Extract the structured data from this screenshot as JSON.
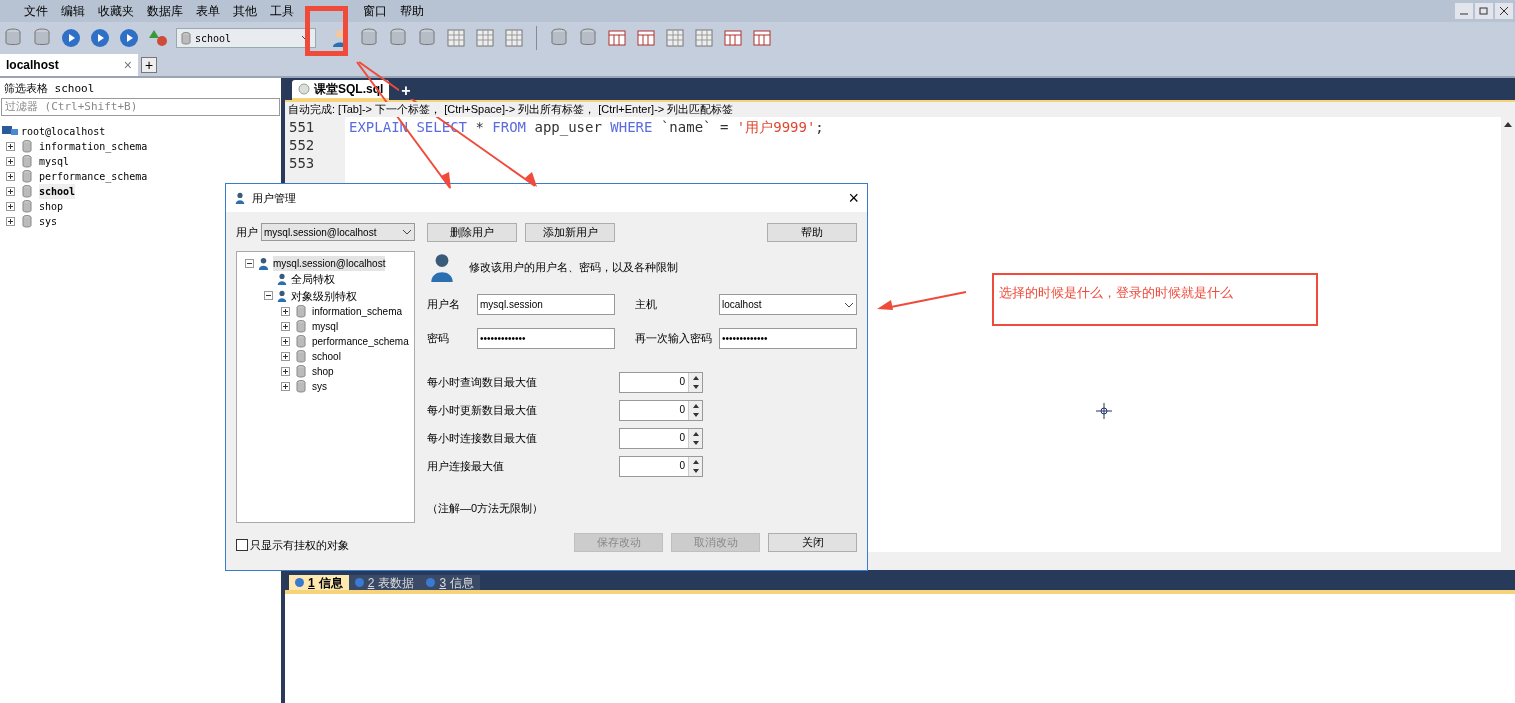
{
  "menu": [
    "文件",
    "编辑",
    "收藏夹",
    "数据库",
    "表单",
    "其他",
    "工具",
    "窗口",
    "帮助"
  ],
  "toolbar": {
    "database_select": "school"
  },
  "connection_tab": {
    "label": "localhost",
    "close": "×",
    "add": "+"
  },
  "sidebar": {
    "filter_label": "筛选表格 school",
    "filter_placeholder": "过滤器 (Ctrl+Shift+B)",
    "tree": {
      "label": "root@localhost",
      "children": [
        {
          "label": "information_schema",
          "selected": false
        },
        {
          "label": "mysql",
          "selected": false
        },
        {
          "label": "performance_schema",
          "selected": false
        },
        {
          "label": "school",
          "selected": true
        },
        {
          "label": "shop",
          "selected": false
        },
        {
          "label": "sys",
          "selected": false
        }
      ]
    }
  },
  "editor": {
    "tab": "课堂SQL.sql",
    "add": "+",
    "hint": "自动完成:  [Tab]-> 下一个标签， [Ctrl+Space]-> 列出所有标签， [Ctrl+Enter]-> 列出匹配标签",
    "lines": [
      {
        "number": "551",
        "tokens": [
          {
            "kind": "keyword",
            "text": "EXPLAIN SELECT"
          },
          {
            "kind": "plain",
            "text": " * "
          },
          {
            "kind": "keyword",
            "text": "FROM"
          },
          {
            "kind": "plain",
            "text": " app_user "
          },
          {
            "kind": "keyword",
            "text": "WHERE"
          },
          {
            "kind": "plain",
            "text": " `name` = "
          },
          {
            "kind": "string",
            "text": "'用户9999'"
          },
          {
            "kind": "plain",
            "text": ";"
          }
        ]
      },
      {
        "number": "552"
      },
      {
        "number": "553"
      }
    ]
  },
  "bottom_tabs": [
    {
      "key": "1",
      "label": "信息",
      "selected": true
    },
    {
      "key": "2",
      "label": "表数据",
      "selected": false
    },
    {
      "key": "3",
      "label": "信息",
      "selected": false
    }
  ],
  "dialog": {
    "title": "用户管理",
    "close": "×",
    "user_label": "用户",
    "user_select": "mysql.session@localhost",
    "buttons": [
      "删除用户",
      "添加新用户"
    ],
    "help_button": "帮助",
    "tree": {
      "label": "mysql.session@localhost",
      "selected": true,
      "children": [
        {
          "label": "全局特权",
          "kind": "global",
          "selected": false
        },
        {
          "label": "对象级别特权",
          "kind": "object",
          "selected": false,
          "children": [
            {
              "label": "information_schema",
              "selected": false
            },
            {
              "label": "mysql",
              "selected": false
            },
            {
              "label": "performance_schema",
              "selected": false
            },
            {
              "label": "school",
              "selected": false
            },
            {
              "label": "shop",
              "selected": false
            },
            {
              "label": "sys",
              "selected": false
            }
          ]
        }
      ]
    },
    "description": "修改该用户的用户名、密码，以及各种限制",
    "username": {
      "label": "用户名",
      "value": "mysql.session"
    },
    "host": {
      "label": "主机",
      "value": "localhost"
    },
    "password": {
      "label": "密码",
      "value": "•••••••••••••"
    },
    "confirm_password": {
      "label": "再一次输入密码",
      "value": "•••••••••••••"
    },
    "limits": [
      {
        "label": "每小时查询数目最大值",
        "value": "0"
      },
      {
        "label": "每小时更新数目最大值",
        "value": "0"
      },
      {
        "label": "每小时连接数目最大值",
        "value": "0"
      },
      {
        "label": "用户连接最大值",
        "value": "0"
      }
    ],
    "note": "（注解—0方法无限制）",
    "show_privileged_only": {
      "label": "只显示有挂权的对象",
      "checked": false
    },
    "footer_buttons": [
      {
        "label": "保存改动",
        "disabled": true
      },
      {
        "label": "取消改动",
        "disabled": true
      },
      {
        "label": "关闭",
        "disabled": false
      }
    ]
  },
  "annotation": {
    "text": "选择的时候是什么，登录的时候就是什么"
  }
}
